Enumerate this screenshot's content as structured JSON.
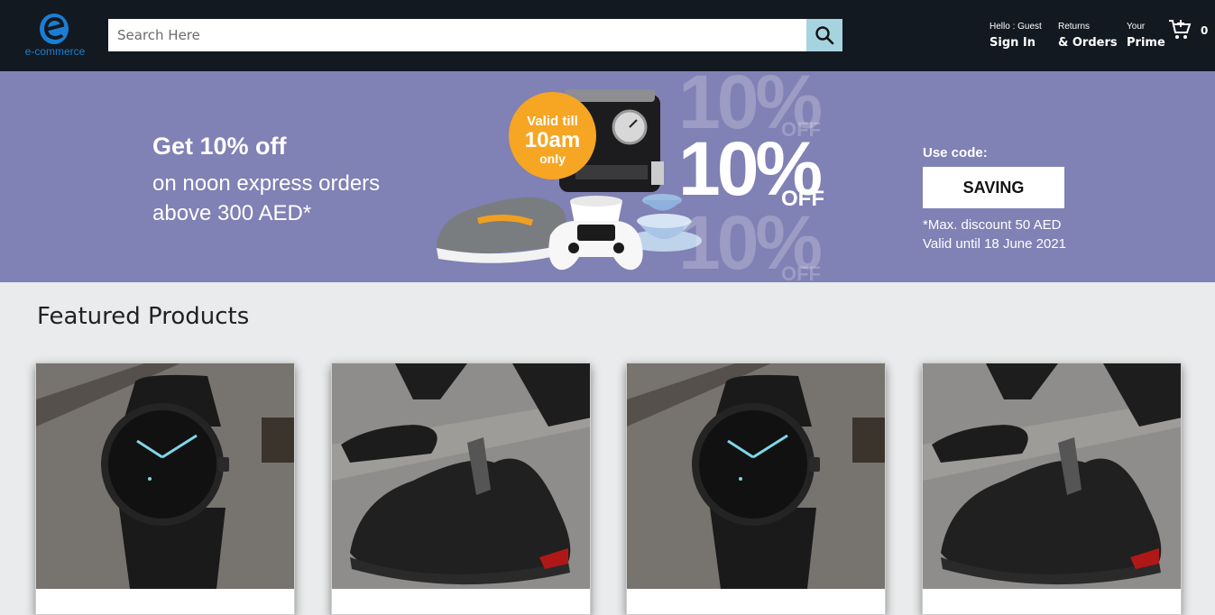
{
  "header": {
    "logo_text": "e-commerce",
    "search": {
      "placeholder": "Search Here"
    },
    "nav": [
      {
        "line1": "Hello : Guest",
        "line2": "Sign In"
      },
      {
        "line1": "Returns",
        "line2": "& Orders"
      },
      {
        "line1": "Your",
        "line2": "Prime"
      }
    ],
    "cart_count": "0"
  },
  "banner": {
    "title": "Get 10% off",
    "subtitle_line1": "on noon express orders",
    "subtitle_line2": "above 300 AED*",
    "badge": {
      "line1": "Valid till",
      "line2": "10am",
      "line3": "only"
    },
    "percent_text": "10%",
    "off_text": "OFF",
    "code_label": "Use code:",
    "code": "SAVING",
    "note_line1": "*Max. discount 50 AED",
    "note_line2": "Valid until 18 June 2021"
  },
  "featured": {
    "title": "Featured Products",
    "products": [
      {
        "image": "watch"
      },
      {
        "image": "sneaker"
      },
      {
        "image": "watch"
      },
      {
        "image": "sneaker"
      }
    ]
  },
  "colors": {
    "header_bg": "#131921",
    "banner_bg": "#8081b4",
    "search_button": "#a6d3e0",
    "badge": "#f6a623",
    "page_bg": "#e9ebec",
    "logo": "#1a7fd4"
  }
}
